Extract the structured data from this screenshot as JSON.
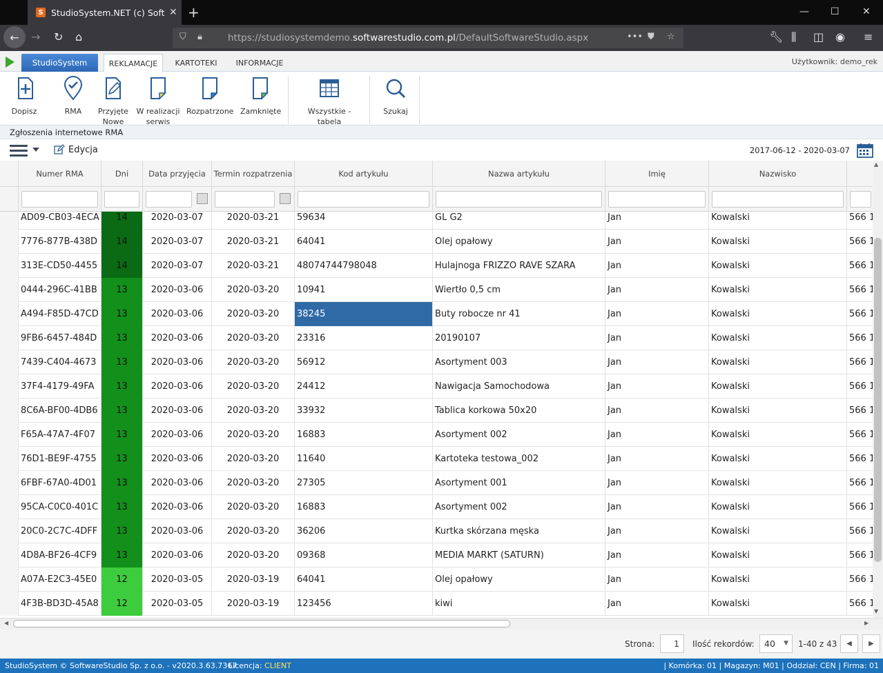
{
  "browser": {
    "tab_title": "StudioSystem.NET (c) SoftwareStudio",
    "url_prefix": "https://studiosystemdemo.",
    "url_domain": "softwarestudio.com.pl",
    "url_path": "/DefaultSoftwareStudio.aspx"
  },
  "app": {
    "brand_tab": "StudioSystem",
    "tabs": [
      "REKLAMACJE",
      "KARTOTEKI",
      "INFORMACJE"
    ],
    "user_label": "Użytkownik: demo_rek"
  },
  "ribbon": {
    "dopisz": "Dopisz",
    "rma": "RMA",
    "przyjete": "Przyjęte",
    "przyjete2": "Nowe",
    "wrealizacji": "W realizacji",
    "wrealizacji2": "serwis",
    "rozpatrzone": "Rozpatrzone",
    "zamkniete": "Zamknięte",
    "wszystkie": "Wszystkie - tabela",
    "szukaj": "Szukaj"
  },
  "section_title": "Zgłoszenia internetowe RMA",
  "toolbar": {
    "edit": "Edycja",
    "date_range": "2017-06-12 - 2020-03-07"
  },
  "grid": {
    "columns": [
      "Numer RMA",
      "Dni",
      "Data przyjęcia",
      "Termin rozpatrzenia",
      "Kod artykułu",
      "Nazwa artykułu",
      "Imię",
      "Nazwisko"
    ],
    "colors": {
      "dark": "#0a6b14",
      "mid": "#138f1c",
      "light": "#3dcc3d"
    },
    "rows": [
      [
        "AD09-CB03-4ECA",
        "14",
        "2020-03-07",
        "2020-03-21",
        "59634",
        "GL G2",
        "Jan",
        "Kowalski",
        "566 1"
      ],
      [
        "7776-877B-438D",
        "14",
        "2020-03-07",
        "2020-03-21",
        "64041",
        "Olej opałowy",
        "Jan",
        "Kowalski",
        "566 1"
      ],
      [
        "313E-CD50-4455",
        "14",
        "2020-03-07",
        "2020-03-21",
        "48074744798048",
        "Hulajnoga FRIZZO RAVE SZARA",
        "Jan",
        "Kowalski",
        "566 1"
      ],
      [
        "0444-296C-41BB",
        "13",
        "2020-03-06",
        "2020-03-20",
        "10941",
        "Wiertło 0,5 cm",
        "Jan",
        "Kowalski",
        "566 1"
      ],
      [
        "A494-F85D-47CD",
        "13",
        "2020-03-06",
        "2020-03-20",
        "38245",
        "Buty robocze nr 41",
        "Jan",
        "Kowalski",
        "566 1"
      ],
      [
        "9FB6-6457-484D",
        "13",
        "2020-03-06",
        "2020-03-20",
        "23316",
        "20190107",
        "Jan",
        "Kowalski",
        "566 1"
      ],
      [
        "7439-C404-4673",
        "13",
        "2020-03-06",
        "2020-03-20",
        "56912",
        "Asortyment 003",
        "Jan",
        "Kowalski",
        "566 1"
      ],
      [
        "37F4-4179-49FA",
        "13",
        "2020-03-06",
        "2020-03-20",
        "24412",
        "Nawigacja Samochodowa",
        "Jan",
        "Kowalski",
        "566 1"
      ],
      [
        "8C6A-BF00-4DB6",
        "13",
        "2020-03-06",
        "2020-03-20",
        "33932",
        "Tablica korkowa 50x20",
        "Jan",
        "Kowalski",
        "566 1"
      ],
      [
        "F65A-47A7-4F07",
        "13",
        "2020-03-06",
        "2020-03-20",
        "16883",
        "Asortyment 002",
        "Jan",
        "Kowalski",
        "566 1"
      ],
      [
        "76D1-BE9F-4755",
        "13",
        "2020-03-06",
        "2020-03-20",
        "11640",
        "Kartoteka testowa_002",
        "Jan",
        "Kowalski",
        "566 1"
      ],
      [
        "6FBF-67A0-4D01",
        "13",
        "2020-03-06",
        "2020-03-20",
        "27305",
        "Asortyment 001",
        "Jan",
        "Kowalski",
        "566 1"
      ],
      [
        "95CA-C0C0-401C",
        "13",
        "2020-03-06",
        "2020-03-20",
        "16883",
        "Asortyment 002",
        "Jan",
        "Kowalski",
        "566 1"
      ],
      [
        "20C0-2C7C-4DFF",
        "13",
        "2020-03-06",
        "2020-03-20",
        "36206",
        "Kurtka skórzana męska",
        "Jan",
        "Kowalski",
        "566 1"
      ],
      [
        "4D8A-BF26-4CF9",
        "13",
        "2020-03-06",
        "2020-03-20",
        "09368",
        "MEDIA MARKT (SATURN)",
        "Jan",
        "Kowalski",
        "566 1"
      ],
      [
        "A07A-E2C3-45E0",
        "12",
        "2020-03-05",
        "2020-03-19",
        "64041",
        "Olej opałowy",
        "Jan",
        "Kowalski",
        "566 1"
      ],
      [
        "4F3B-BD3D-45A8",
        "12",
        "2020-03-05",
        "2020-03-19",
        "123456",
        "kiwi",
        "Jan",
        "Kowalski",
        "566 1"
      ]
    ]
  },
  "pager": {
    "page_label": "Strona:",
    "page": "1",
    "records_label": "Ilość rekordów:",
    "records": "40",
    "range": "1-40 z 43"
  },
  "status": {
    "left": "StudioSystem © SoftwareStudio Sp. z o.o. - v2020.3.63.7367",
    "license_label": "Licencja:",
    "license_value": "CLIENT",
    "right": "| Komórka: 01 | Magazyn: M01 | Oddział: CEN | Firma: 01"
  }
}
